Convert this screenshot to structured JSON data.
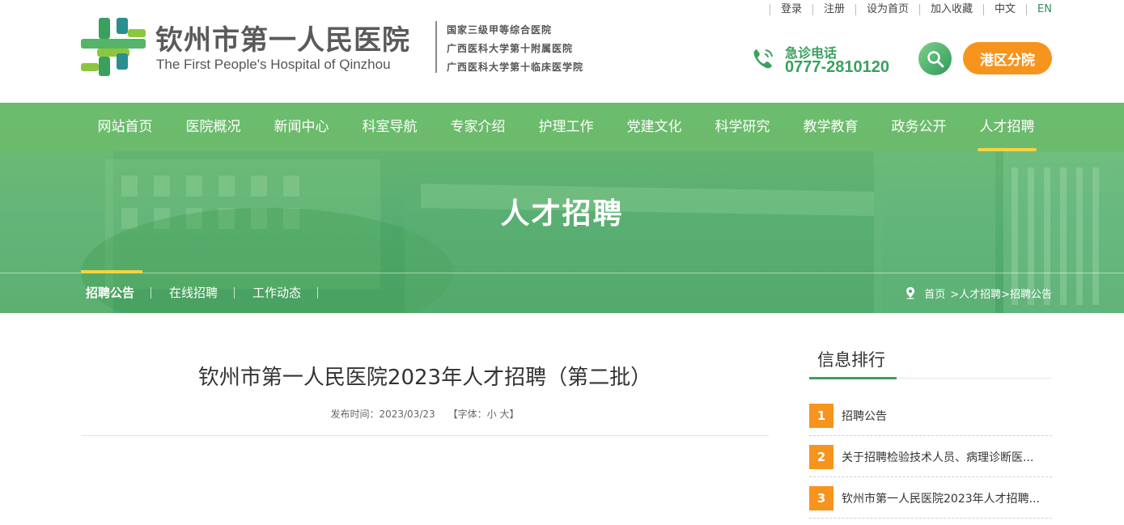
{
  "header": {
    "logo_cn": "钦州市第一人民医院",
    "logo_en": "The First People's Hospital of Qinzhou",
    "subtitles": [
      "国家三级甲等综合医院",
      "广西医科大学第十附属医院",
      "广西医科大学第十临床医学院"
    ],
    "top_links": [
      "登录",
      "注册",
      "设为首页",
      "加入收藏",
      "中文",
      "EN"
    ],
    "hotline_label": "急诊电话",
    "hotline_number": "0777-2810120",
    "branch_button": "港区分院",
    "brand_color": "#3aa05e",
    "accent_color": "#f7941d"
  },
  "nav": {
    "items": [
      "网站首页",
      "医院概况",
      "新闻中心",
      "科室导航",
      "专家介绍",
      "护理工作",
      "党建文化",
      "科学研究",
      "教学教育",
      "政务公开",
      "人才招聘"
    ],
    "active": "人才招聘"
  },
  "banner": {
    "title": "人才招聘"
  },
  "subnav": {
    "items": [
      "招聘公告",
      "在线招聘",
      "工作动态"
    ],
    "active": "招聘公告"
  },
  "breadcrumb": {
    "home": "首页",
    "path": ">人才招聘>招聘公告"
  },
  "article": {
    "title": "钦州市第一人民医院2023年人才招聘（第二批）",
    "publish_label": "发布时间：2023/03/23",
    "font_label_open": "【字体：",
    "font_small": "小",
    "font_large": "大",
    "font_label_close": "】"
  },
  "sidebar": {
    "title": "信息排行",
    "items": [
      {
        "rank": "1",
        "text": "招聘公告"
      },
      {
        "rank": "2",
        "text": "关于招聘检验技术人员、病理诊断医..."
      },
      {
        "rank": "3",
        "text": "钦州市第一人民医院2023年人才招聘..."
      }
    ]
  }
}
